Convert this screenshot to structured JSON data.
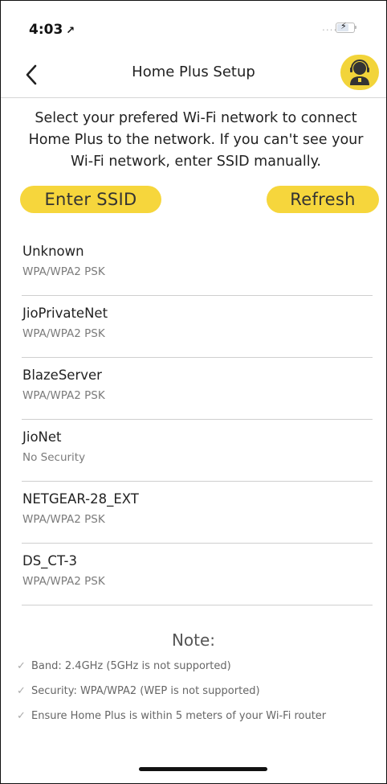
{
  "status_bar": {
    "time": "4:03",
    "location_arrow": "↗",
    "signal": "....."
  },
  "header": {
    "title": "Home Plus Setup",
    "back_icon": "chevron-left-icon",
    "support_icon": "support-agent-icon"
  },
  "instructions": "Select your prefered Wi-Fi network to connect Home Plus to the network. If you can't see your Wi-Fi network, enter SSID manually.",
  "buttons": {
    "enter_ssid": "Enter SSID",
    "refresh": "Refresh"
  },
  "networks": [
    {
      "name": "Unknown",
      "security": "WPA/WPA2 PSK"
    },
    {
      "name": "JioPrivateNet",
      "security": "WPA/WPA2 PSK"
    },
    {
      "name": "BlazeServer",
      "security": "WPA/WPA2 PSK"
    },
    {
      "name": "JioNet",
      "security": "No Security"
    },
    {
      "name": "NETGEAR-28_EXT",
      "security": "WPA/WPA2 PSK"
    },
    {
      "name": "DS_CT-3",
      "security": "WPA/WPA2 PSK"
    }
  ],
  "note": {
    "title": "Note:",
    "items": [
      "Band: 2.4GHz (5GHz is not supported)",
      "Security: WPA/WPA2 (WEP is not supported)",
      "Ensure Home Plus is within 5 meters of your Wi-Fi router"
    ]
  },
  "colors": {
    "accent": "#F6D63C",
    "divider": "#CFCFCF"
  }
}
